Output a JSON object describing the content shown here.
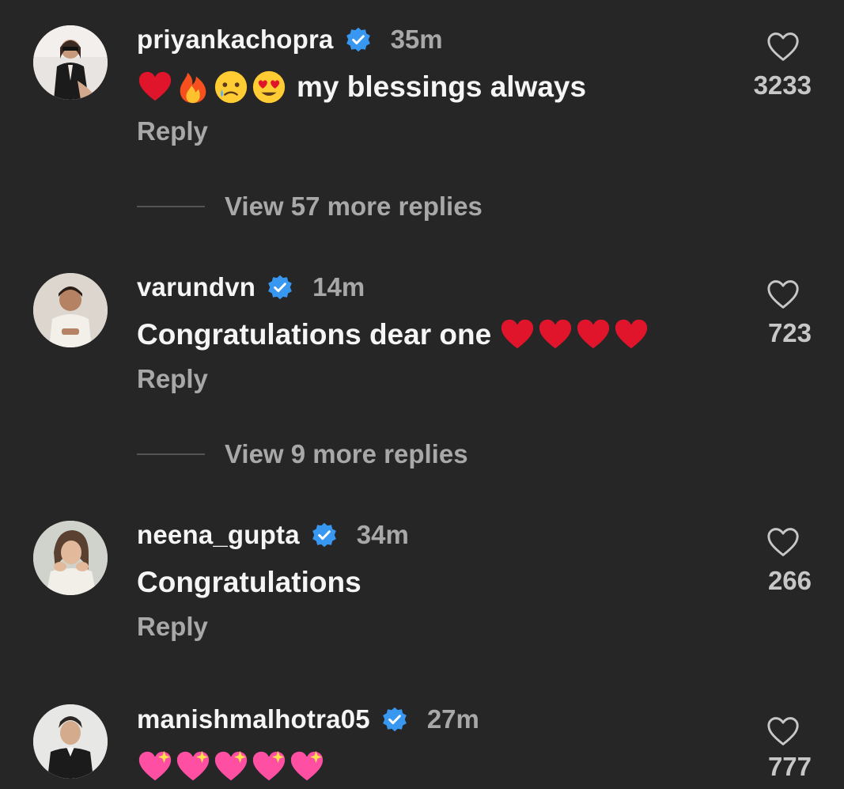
{
  "colors": {
    "background": "#262626",
    "primary_text": "#f5f5f5",
    "secondary_text": "#a8a8a8",
    "verified_blue": "#3897f0"
  },
  "comments": [
    {
      "username": "priyankachopra",
      "verified": true,
      "time": "35m",
      "emojis_before": [
        "red-heart",
        "fire",
        "crying-face",
        "heart-eyes-face"
      ],
      "text": "my blessings always",
      "emojis_after": [],
      "reply_label": "Reply",
      "likes": "3233",
      "view_replies": "View 57 more replies"
    },
    {
      "username": "varundvn",
      "verified": true,
      "time": "14m",
      "emojis_before": [],
      "text": "Congratulations dear one",
      "emojis_after": [
        "red-heart",
        "red-heart",
        "red-heart",
        "red-heart"
      ],
      "reply_label": "Reply",
      "likes": "723",
      "view_replies": "View 9 more replies"
    },
    {
      "username": "neena_gupta",
      "verified": true,
      "time": "34m",
      "emojis_before": [],
      "text": "Congratulations",
      "emojis_after": [],
      "reply_label": "Reply",
      "likes": "266"
    },
    {
      "username": "manishmalhotra05",
      "verified": true,
      "time": "27m",
      "emojis_before": [
        "sparkling-heart",
        "sparkling-heart",
        "sparkling-heart",
        "sparkling-heart",
        "sparkling-heart"
      ],
      "text": "",
      "emojis_after": [],
      "likes": "777"
    }
  ]
}
